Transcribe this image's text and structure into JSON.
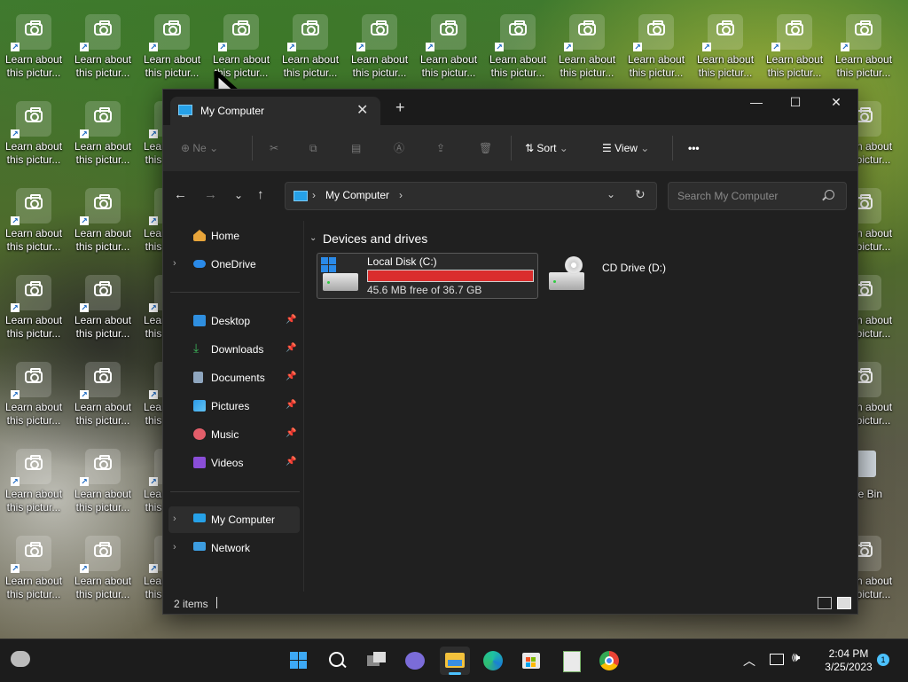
{
  "desktop": {
    "icon_label": "Learn about\nthis pictur...",
    "recycle_bin_label": "ycle Bin"
  },
  "window": {
    "tab_title": "My Computer",
    "toolbar": {
      "new_label": "Ne",
      "sort_label": "Sort",
      "view_label": "View",
      "more_label": "•••"
    },
    "address": {
      "breadcrumb": "My Computer"
    },
    "search": {
      "placeholder": "Search My Computer"
    },
    "sidebar": {
      "items": [
        {
          "label": "Home",
          "icon": "home-icon"
        },
        {
          "label": "OneDrive",
          "icon": "onedrive-icon"
        },
        {
          "label": "Desktop",
          "icon": "desktop-folder-icon",
          "pinned": true
        },
        {
          "label": "Downloads",
          "icon": "downloads-folder-icon",
          "pinned": true
        },
        {
          "label": "Documents",
          "icon": "documents-folder-icon",
          "pinned": true
        },
        {
          "label": "Pictures",
          "icon": "pictures-folder-icon",
          "pinned": true
        },
        {
          "label": "Music",
          "icon": "music-folder-icon",
          "pinned": true
        },
        {
          "label": "Videos",
          "icon": "videos-folder-icon",
          "pinned": true
        },
        {
          "label": "My Computer",
          "icon": "computer-icon",
          "selected": true
        },
        {
          "label": "Network",
          "icon": "network-icon"
        }
      ]
    },
    "content": {
      "group_header": "Devices and drives",
      "drives": [
        {
          "name": "Local Disk (C:)",
          "free_text": "45.6 MB free of 36.7 GB",
          "used_fraction": 0.999
        },
        {
          "name": "CD Drive (D:)"
        }
      ]
    },
    "status": {
      "item_count": "2 items"
    }
  },
  "taskbar": {
    "clock_time": "2:04 PM",
    "clock_date": "3/25/2023",
    "notification_count": "1"
  },
  "colors": {
    "accent": "#4cc2ff",
    "drive_full": "#da2d2d",
    "window_bg": "#202020"
  }
}
